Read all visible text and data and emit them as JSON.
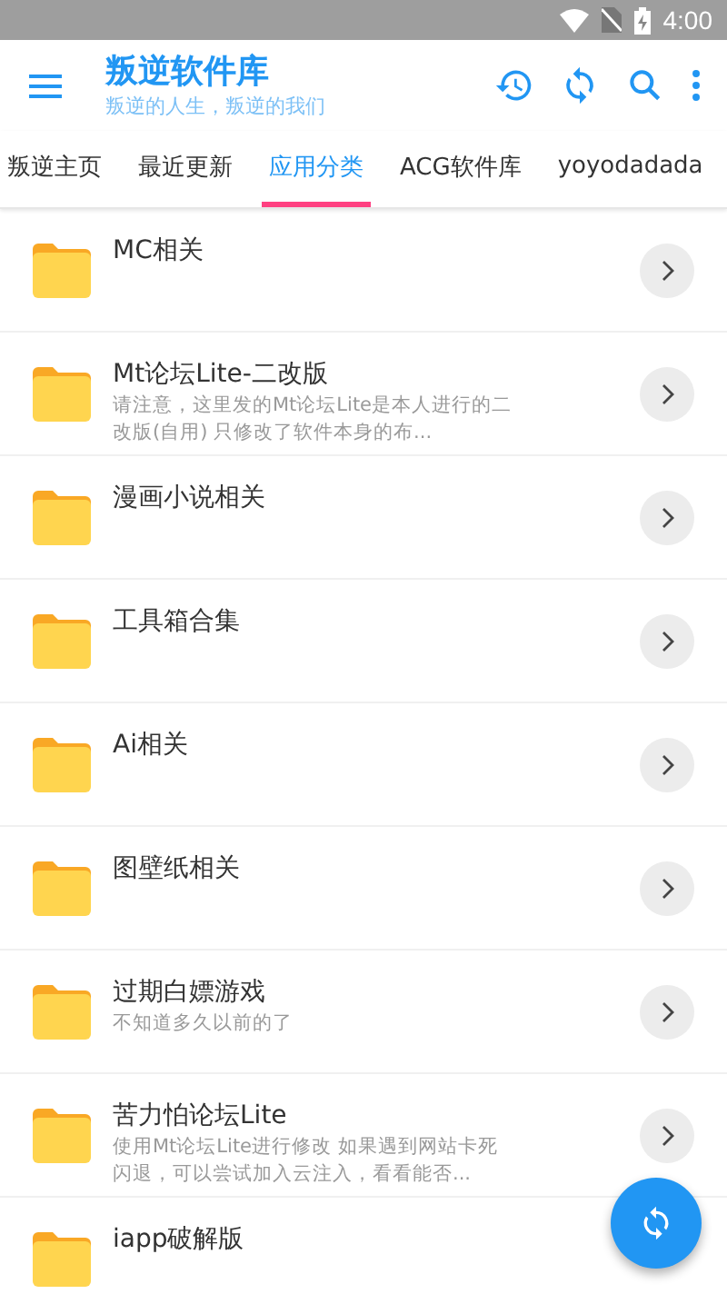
{
  "status_bar": {
    "time": "4:00"
  },
  "app_bar": {
    "title": "叛逆软件库",
    "subtitle": "叛逆的人生，叛逆的我们"
  },
  "tabs": [
    {
      "label": "叛逆主页",
      "selected": false
    },
    {
      "label": "最近更新",
      "selected": false
    },
    {
      "label": "应用分类",
      "selected": true
    },
    {
      "label": "ACG软件库",
      "selected": false
    },
    {
      "label": "yoyodadada",
      "selected": false
    }
  ],
  "items": [
    {
      "title": "MC相关"
    },
    {
      "title": "Mt论坛Lite-二改版",
      "description": "请注意，这里发的Mt论坛Lite是本人进行的二改版(自用) 只修改了软件本身的布..."
    },
    {
      "title": "漫画小说相关"
    },
    {
      "title": "工具箱合集"
    },
    {
      "title": "Ai相关"
    },
    {
      "title": "图壁纸相关"
    },
    {
      "title": "过期白嫖游戏",
      "description": "不知道多久以前的了"
    },
    {
      "title": "苦力怕论坛Lite",
      "description": "使用Mt论坛Lite进行修改 如果遇到网站卡死闪退，可以尝试加入云注入，看看能否..."
    },
    {
      "title": "iapp破解版"
    }
  ]
}
